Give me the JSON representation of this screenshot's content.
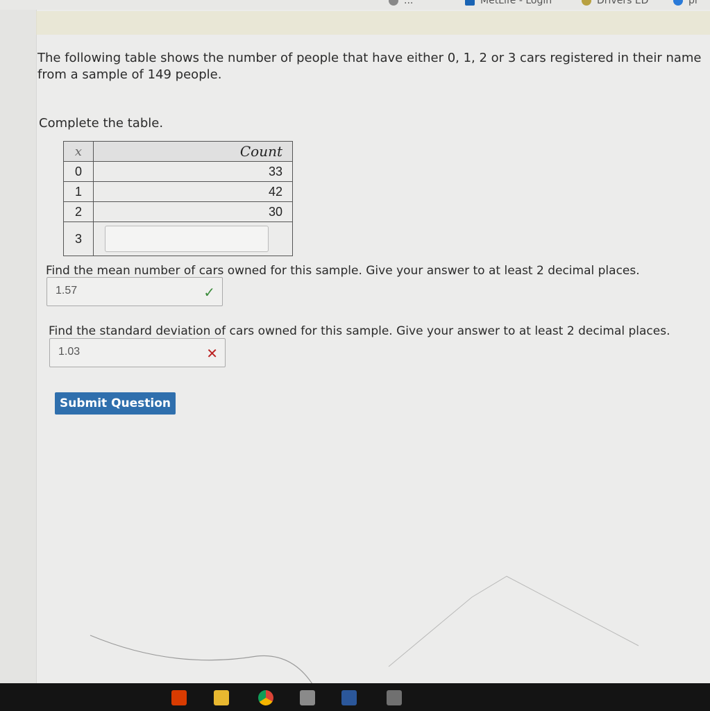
{
  "bookmarks": [
    {
      "label": "...",
      "icon": "app-icon"
    },
    {
      "label": "MetLife - Login",
      "icon": "metlife-icon"
    },
    {
      "label": "Drivers ED",
      "icon": "drivers-ed-icon"
    },
    {
      "label": "pr",
      "icon": "browser-profile-icon"
    }
  ],
  "question": {
    "intro": "The following table shows the number of people that have either 0, 1, 2 or 3 cars registered in their name from a sample of 149 people.",
    "complete_prompt": "Complete the table.",
    "table": {
      "headers": {
        "x": "x",
        "count": "Count"
      },
      "rows": [
        {
          "x": "0",
          "count": "33"
        },
        {
          "x": "1",
          "count": "42"
        },
        {
          "x": "2",
          "count": "30"
        },
        {
          "x": "3",
          "count": ""
        }
      ]
    },
    "mean_prompt": "Find the mean number of cars owned for this sample. Give your answer to at least 2 decimal places.",
    "mean_answer": "1.57",
    "mean_status": "correct",
    "sd_prompt": "Find the standard deviation of cars owned for this sample. Give your answer to at least 2 decimal places.",
    "sd_answer": "1.03",
    "sd_status": "incorrect",
    "submit_label": "Submit Question"
  },
  "marks": {
    "check": "✓",
    "cross": "✕"
  },
  "taskbar": [
    "office-icon",
    "file-explorer-icon",
    "chrome-icon",
    "microsoft-store-icon",
    "word-icon",
    "calculator-icon"
  ],
  "colors": {
    "submit_bg": "#2f6fad",
    "check": "#3b8b3b",
    "cross": "#b22222"
  }
}
